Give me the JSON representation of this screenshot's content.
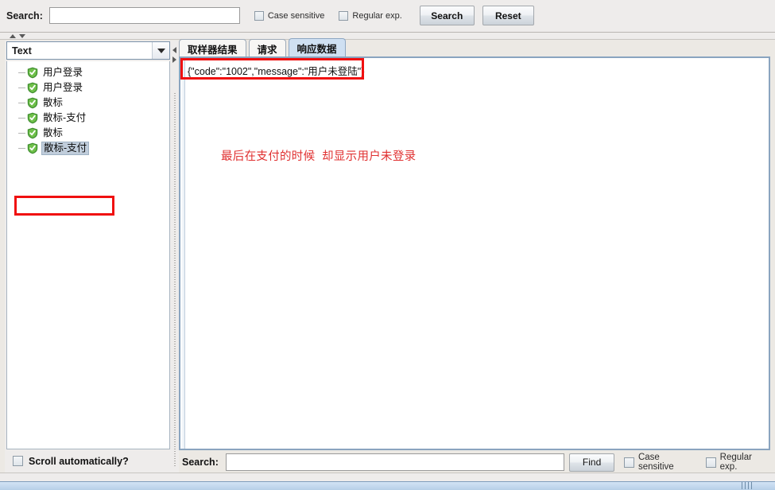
{
  "top_search": {
    "label": "Search:",
    "value": "",
    "placeholder": "",
    "case_sensitive_label": "Case sensitive",
    "regular_exp_label": "Regular exp.",
    "search_button": "Search",
    "reset_button": "Reset"
  },
  "left_panel": {
    "combo_value": "Text",
    "tree_items": [
      {
        "label": "用户登录",
        "selected": false
      },
      {
        "label": "用户登录",
        "selected": false
      },
      {
        "label": "散标",
        "selected": false
      },
      {
        "label": "散标-支付",
        "selected": false
      },
      {
        "label": "散标",
        "selected": false
      },
      {
        "label": "散标-支付",
        "selected": true
      }
    ],
    "scroll_automatically_label": "Scroll automatically?"
  },
  "right_panel": {
    "tabs": [
      {
        "label": "取样器结果",
        "active": false
      },
      {
        "label": "请求",
        "active": false
      },
      {
        "label": "响应数据",
        "active": true
      }
    ],
    "response_text": "{\"code\":\"1002\",\"message\":\"用户未登陆\"}",
    "annotation_text": "最后在支付的时候  却显示用户未登录",
    "annotation_color": "#e03030",
    "highlight_box_color": "#f01010"
  },
  "find_bar": {
    "label": "Search:",
    "value": "",
    "placeholder": "",
    "find_button": "Find",
    "case_sensitive_label": "Case sensitive",
    "regular_exp_label": "Regular exp."
  }
}
